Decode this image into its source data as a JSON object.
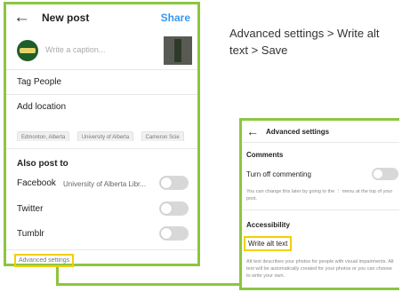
{
  "new_post": {
    "back_icon": "arrow-left-icon",
    "title": "New post",
    "share_label": "Share",
    "caption_placeholder": "Write a caption...",
    "tag_people_label": "Tag People",
    "add_location_label": "Add location",
    "location_suggestions": [
      "Edmonton, Alberta",
      "University of Alberta",
      "Cameron Scie"
    ],
    "also_post_to_label": "Also post to",
    "share_targets": [
      {
        "label": "Facebook",
        "sublabel": "University of Alberta Libr...",
        "enabled": false
      },
      {
        "label": "Twitter",
        "sublabel": "",
        "enabled": false
      },
      {
        "label": "Tumblr",
        "sublabel": "",
        "enabled": false
      }
    ],
    "advanced_settings_label": "Advanced settings"
  },
  "instruction": {
    "text": "Advanced settings > Write alt text > Save"
  },
  "advanced_settings": {
    "back_icon": "arrow-left-icon",
    "title": "Advanced settings",
    "comments_section": "Comments",
    "turn_off_commenting_label": "Turn off commenting",
    "turn_off_commenting_enabled": false,
    "commenting_help": "You can change this later by going to the ⋮ menu at the top of your post.",
    "accessibility_section": "Accessibility",
    "write_alt_text_label": "Write alt text",
    "alt_text_help": "Alt text describes your photos for people with visual impairments. Alt text will be automatically created for your photos or you can choose to write your own."
  },
  "colors": {
    "highlight_border": "#8cc63f",
    "focus_box": "#f2d000",
    "share_link": "#3897f0",
    "toggle_off": "#d8d8d8"
  }
}
